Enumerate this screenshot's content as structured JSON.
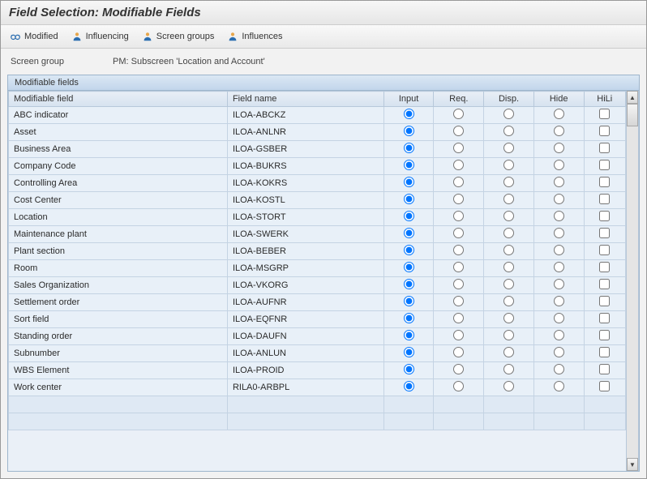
{
  "title": "Field Selection: Modifiable Fields",
  "toolbar": {
    "modified": "Modified",
    "influencing": "Influencing",
    "screen_groups": "Screen groups",
    "influences": "Influences"
  },
  "info": {
    "label": "Screen group",
    "value": "PM: Subscreen 'Location and Account'"
  },
  "panel": {
    "title": "Modifiable fields"
  },
  "columns": {
    "mf": "Modifiable field",
    "fn": "Field name",
    "input": "Input",
    "req": "Req.",
    "disp": "Disp.",
    "hide": "Hide",
    "hili": "HiLi"
  },
  "rows": [
    {
      "mf": "ABC indicator",
      "fn": "ILOA-ABCKZ",
      "sel": "input"
    },
    {
      "mf": "Asset",
      "fn": "ILOA-ANLNR",
      "sel": "input"
    },
    {
      "mf": "Business Area",
      "fn": "ILOA-GSBER",
      "sel": "input"
    },
    {
      "mf": "Company Code",
      "fn": "ILOA-BUKRS",
      "sel": "input"
    },
    {
      "mf": "Controlling Area",
      "fn": "ILOA-KOKRS",
      "sel": "input"
    },
    {
      "mf": "Cost Center",
      "fn": "ILOA-KOSTL",
      "sel": "input"
    },
    {
      "mf": "Location",
      "fn": "ILOA-STORT",
      "sel": "input"
    },
    {
      "mf": "Maintenance plant",
      "fn": "ILOA-SWERK",
      "sel": "input"
    },
    {
      "mf": "Plant section",
      "fn": "ILOA-BEBER",
      "sel": "input"
    },
    {
      "mf": "Room",
      "fn": "ILOA-MSGRP",
      "sel": "input"
    },
    {
      "mf": "Sales Organization",
      "fn": "ILOA-VKORG",
      "sel": "input"
    },
    {
      "mf": "Settlement order",
      "fn": "ILOA-AUFNR",
      "sel": "input"
    },
    {
      "mf": "Sort field",
      "fn": "ILOA-EQFNR",
      "sel": "input"
    },
    {
      "mf": "Standing order",
      "fn": "ILOA-DAUFN",
      "sel": "input"
    },
    {
      "mf": "Subnumber",
      "fn": "ILOA-ANLUN",
      "sel": "input"
    },
    {
      "mf": "WBS Element",
      "fn": "ILOA-PROID",
      "sel": "input"
    },
    {
      "mf": "Work center",
      "fn": "RILA0-ARBPL",
      "sel": "input"
    }
  ],
  "empty_rows": 2
}
